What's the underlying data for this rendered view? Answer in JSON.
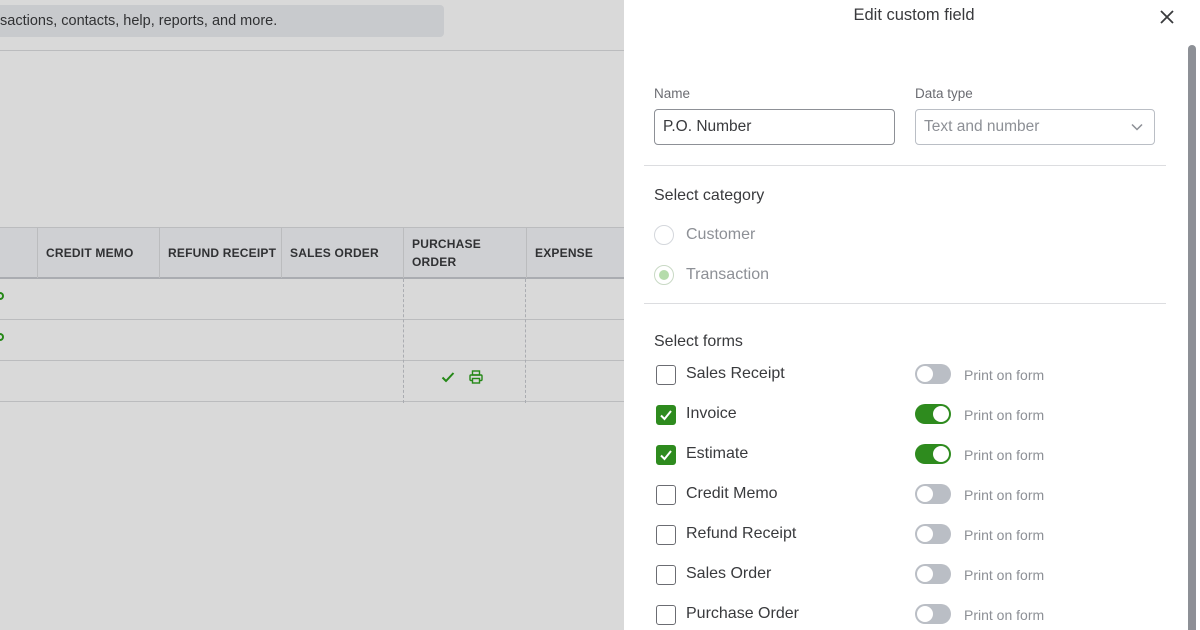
{
  "background": {
    "search_text": "sactions, contacts, help, reports, and more.",
    "columns": [
      "CREDIT MEMO",
      "REFUND RECEIPT",
      "SALES ORDER",
      "PURCHASE ORDER",
      "EXPENSE"
    ]
  },
  "drawer": {
    "title": "Edit custom field",
    "name_label": "Name",
    "name_value": "P.O. Number",
    "data_type_label": "Data type",
    "data_type_value": "Text and number",
    "category_title": "Select category",
    "categories": [
      {
        "label": "Customer",
        "selected": false
      },
      {
        "label": "Transaction",
        "selected": true
      }
    ],
    "forms_title": "Select forms",
    "print_label": "Print on form",
    "forms": [
      {
        "label": "Sales Receipt",
        "checked": false,
        "print": false
      },
      {
        "label": "Invoice",
        "checked": true,
        "print": true
      },
      {
        "label": "Estimate",
        "checked": true,
        "print": true
      },
      {
        "label": "Credit Memo",
        "checked": false,
        "print": false
      },
      {
        "label": "Refund Receipt",
        "checked": false,
        "print": false
      },
      {
        "label": "Sales Order",
        "checked": false,
        "print": false
      },
      {
        "label": "Purchase Order",
        "checked": false,
        "print": false
      }
    ]
  },
  "colors": {
    "accent_green": "#2e8b1e",
    "text": "#393a3d",
    "muted": "#8d9096"
  }
}
